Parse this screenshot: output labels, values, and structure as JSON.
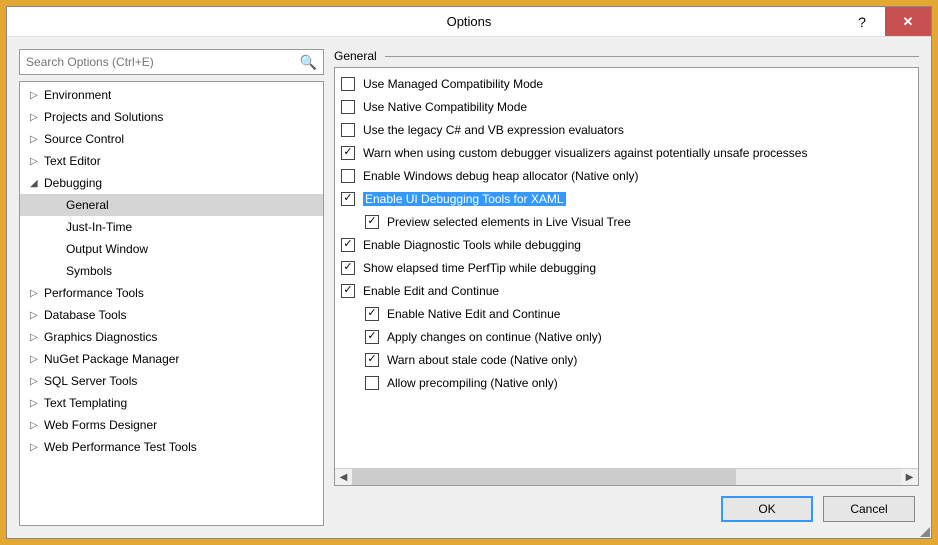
{
  "window": {
    "title": "Options"
  },
  "search": {
    "placeholder": "Search Options (Ctrl+E)"
  },
  "tree": [
    {
      "label": "Environment",
      "expanded": false,
      "children": []
    },
    {
      "label": "Projects and Solutions",
      "expanded": false,
      "children": []
    },
    {
      "label": "Source Control",
      "expanded": false,
      "children": []
    },
    {
      "label": "Text Editor",
      "expanded": false,
      "children": []
    },
    {
      "label": "Debugging",
      "expanded": true,
      "children": [
        {
          "label": "General",
          "selected": true
        },
        {
          "label": "Just-In-Time"
        },
        {
          "label": "Output Window"
        },
        {
          "label": "Symbols"
        }
      ]
    },
    {
      "label": "Performance Tools",
      "expanded": false,
      "children": []
    },
    {
      "label": "Database Tools",
      "expanded": false,
      "children": []
    },
    {
      "label": "Graphics Diagnostics",
      "expanded": false,
      "children": []
    },
    {
      "label": "NuGet Package Manager",
      "expanded": false,
      "children": []
    },
    {
      "label": "SQL Server Tools",
      "expanded": false,
      "children": []
    },
    {
      "label": "Text Templating",
      "expanded": false,
      "children": []
    },
    {
      "label": "Web Forms Designer",
      "expanded": false,
      "children": []
    },
    {
      "label": "Web Performance Test Tools",
      "expanded": false,
      "children": []
    }
  ],
  "section": {
    "title": "General"
  },
  "options": [
    {
      "label": "Use Managed Compatibility Mode",
      "checked": false,
      "indent": 0,
      "highlight": false
    },
    {
      "label": "Use Native Compatibility Mode",
      "checked": false,
      "indent": 0,
      "highlight": false
    },
    {
      "label": "Use the legacy C# and VB expression evaluators",
      "checked": false,
      "indent": 0,
      "highlight": false
    },
    {
      "label": "Warn when using custom debugger visualizers against potentially unsafe processes",
      "checked": true,
      "indent": 0,
      "highlight": false
    },
    {
      "label": "Enable Windows debug heap allocator (Native only)",
      "checked": false,
      "indent": 0,
      "highlight": false
    },
    {
      "label": "Enable UI Debugging Tools for XAML",
      "checked": true,
      "indent": 0,
      "highlight": true
    },
    {
      "label": "Preview selected elements in Live Visual Tree",
      "checked": true,
      "indent": 1,
      "highlight": false
    },
    {
      "label": "Enable Diagnostic Tools while debugging",
      "checked": true,
      "indent": 0,
      "highlight": false
    },
    {
      "label": "Show elapsed time PerfTip while debugging",
      "checked": true,
      "indent": 0,
      "highlight": false
    },
    {
      "label": "Enable Edit and Continue",
      "checked": true,
      "indent": 0,
      "highlight": false
    },
    {
      "label": "Enable Native Edit and Continue",
      "checked": true,
      "indent": 1,
      "highlight": false
    },
    {
      "label": "Apply changes on continue (Native only)",
      "checked": true,
      "indent": 1,
      "highlight": false
    },
    {
      "label": "Warn about stale code (Native only)",
      "checked": true,
      "indent": 1,
      "highlight": false
    },
    {
      "label": "Allow precompiling (Native only)",
      "checked": false,
      "indent": 1,
      "highlight": false
    }
  ],
  "buttons": {
    "ok": "OK",
    "cancel": "Cancel"
  }
}
